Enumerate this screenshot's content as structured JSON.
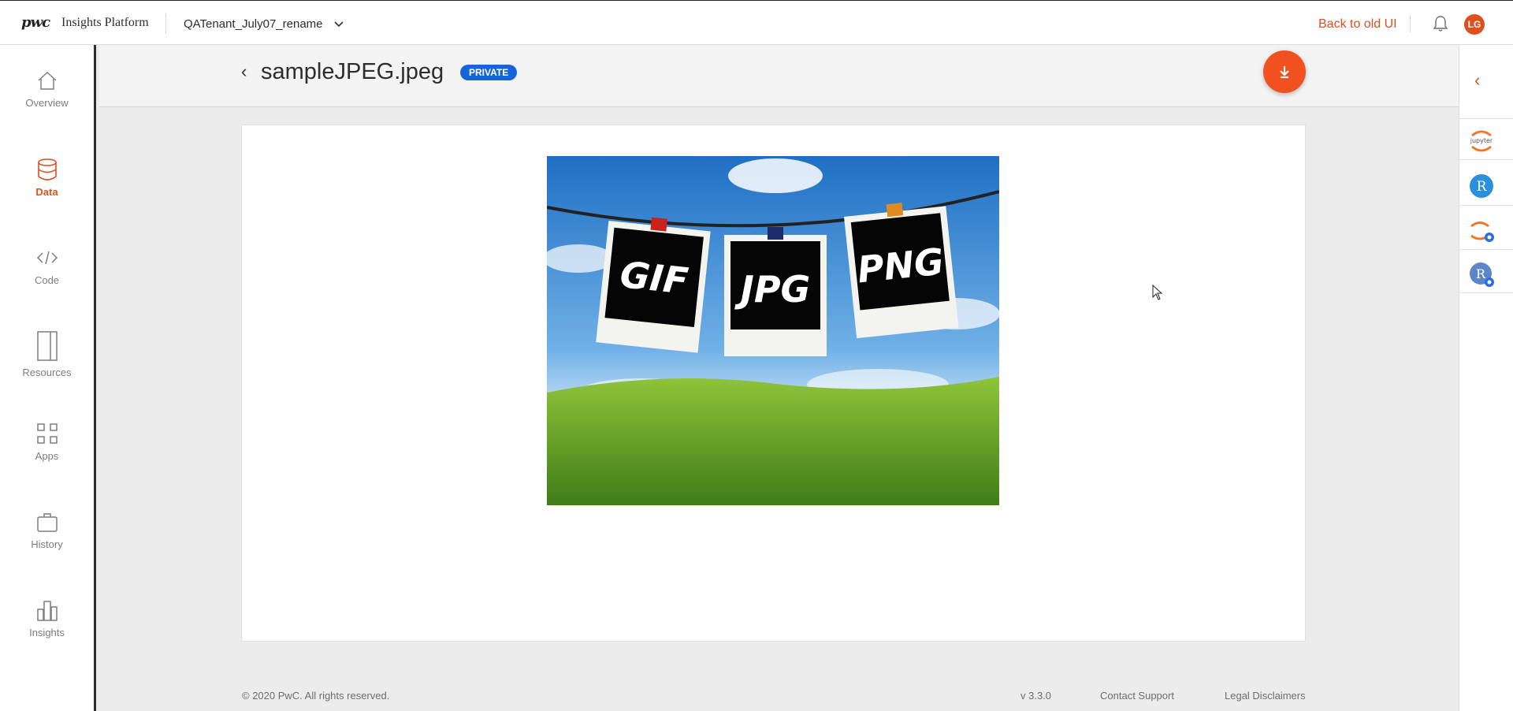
{
  "topbar": {
    "logo": "pwc",
    "product": "Insights Platform",
    "tenant": "QATenant_July07_rename",
    "back_link": "Back to old UI",
    "avatar_initials": "LG",
    "accent_color": "#e0501f"
  },
  "sidebar": {
    "items": [
      {
        "label": "Overview",
        "icon": "home-icon"
      },
      {
        "label": "Data",
        "icon": "database-icon",
        "active": true
      },
      {
        "label": "Code",
        "icon": "code-icon"
      },
      {
        "label": "Resources",
        "icon": "notebook-icon"
      },
      {
        "label": "Apps",
        "icon": "grid-icon"
      },
      {
        "label": "History",
        "icon": "briefcase-icon"
      },
      {
        "label": "Insights",
        "icon": "bar-chart-icon"
      }
    ]
  },
  "file": {
    "name": "sampleJPEG.jpeg",
    "visibility": "PRIVATE",
    "preview_labels": [
      "GIF",
      "JPG",
      "PNG"
    ]
  },
  "footer": {
    "copyright": "© 2020 PwC. All rights reserved.",
    "version": "v 3.3.0",
    "support": "Contact Support",
    "legal": "Legal Disclaimers"
  },
  "right_panel": {
    "tools": [
      "jupyter-icon",
      "r-icon",
      "jupyter-cluster-icon",
      "r-cluster-icon"
    ],
    "tool_texts": {
      "jupyter": "jupyter",
      "r": "R"
    }
  }
}
